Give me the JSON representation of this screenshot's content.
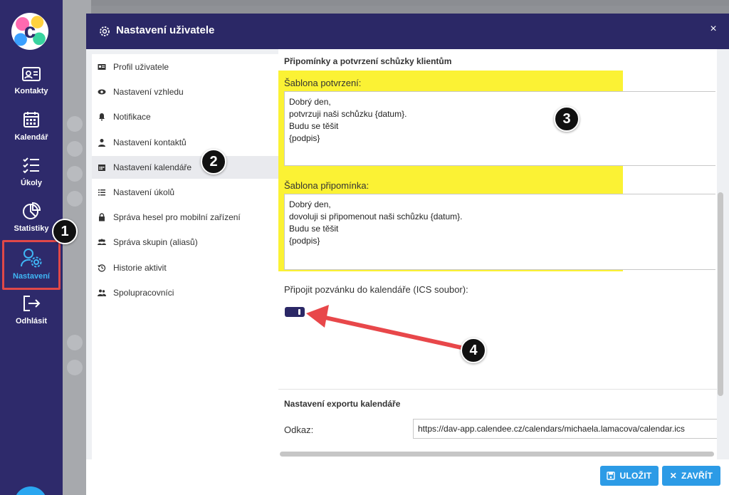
{
  "app": {
    "logo_letter": "c",
    "nav": [
      {
        "label": "Kontakty",
        "icon": "contact-card-icon"
      },
      {
        "label": "Kalendář",
        "icon": "calendar-icon"
      },
      {
        "label": "Úkoly",
        "icon": "checklist-icon"
      },
      {
        "label": "Statistiky",
        "icon": "pie-chart-icon"
      },
      {
        "label": "Nastavení",
        "icon": "user-settings-icon"
      },
      {
        "label": "Odhlásit",
        "icon": "logout-icon"
      }
    ],
    "active_nav": "Nastavení"
  },
  "modal": {
    "title": "Nastavení uživatele",
    "close_icon": "×",
    "menu": [
      {
        "label": "Profil uživatele",
        "icon": "id-card-icon"
      },
      {
        "label": "Nastavení vzhledu",
        "icon": "eye-icon"
      },
      {
        "label": "Notifikace",
        "icon": "bell-icon"
      },
      {
        "label": "Nastavení kontaktů",
        "icon": "person-icon"
      },
      {
        "label": "Nastavení kalendáře",
        "icon": "calendar-icon"
      },
      {
        "label": "Nastavení úkolů",
        "icon": "task-list-icon"
      },
      {
        "label": "Správa hesel pro mobilní zařízení",
        "icon": "lock-icon"
      },
      {
        "label": "Správa skupin (aliasů)",
        "icon": "group-icon"
      },
      {
        "label": "Historie aktivit",
        "icon": "history-icon"
      },
      {
        "label": "Spolupracovníci",
        "icon": "users-icon"
      }
    ],
    "active_menu": "Nastavení kalendáře",
    "content": {
      "reminders_section_title": "Připomínky a potvrzení schůzky klientům",
      "confirmation_label": "Šablona potvrzení:",
      "confirmation_lines": [
        "Dobrý den,",
        "potvrzuji naši schůzku {datum}.",
        "Budu se těšit",
        "{podpis}"
      ],
      "reminder_label": "Šablona připomínka:",
      "reminder_lines": [
        "Dobrý den,",
        "dovoluji si připomenout naši schůzku {datum}.",
        "Budu se těšit",
        "{podpis}"
      ],
      "ics_label": "Připojit pozvánku do kalendáře (ICS soubor):",
      "ics_enabled": true,
      "export_section_title": "Nastavení exportu kalendáře",
      "link_label": "Odkaz:",
      "link_value": "https://dav-app.calendee.cz/calendars/michaela.lamacova/calendar.ics"
    },
    "footer": {
      "save_label": "ULOŽIT",
      "close_label": "ZAVŘÍT"
    }
  },
  "annotations": [
    "1",
    "2",
    "3",
    "4"
  ],
  "colors": {
    "rail": "#2e2a6b",
    "header": "#2b2866",
    "accent": "#2c9be6",
    "highlight": "#fbf234",
    "annotation_arrow": "#e8474a",
    "active_nav_text": "#3fb6f5"
  }
}
